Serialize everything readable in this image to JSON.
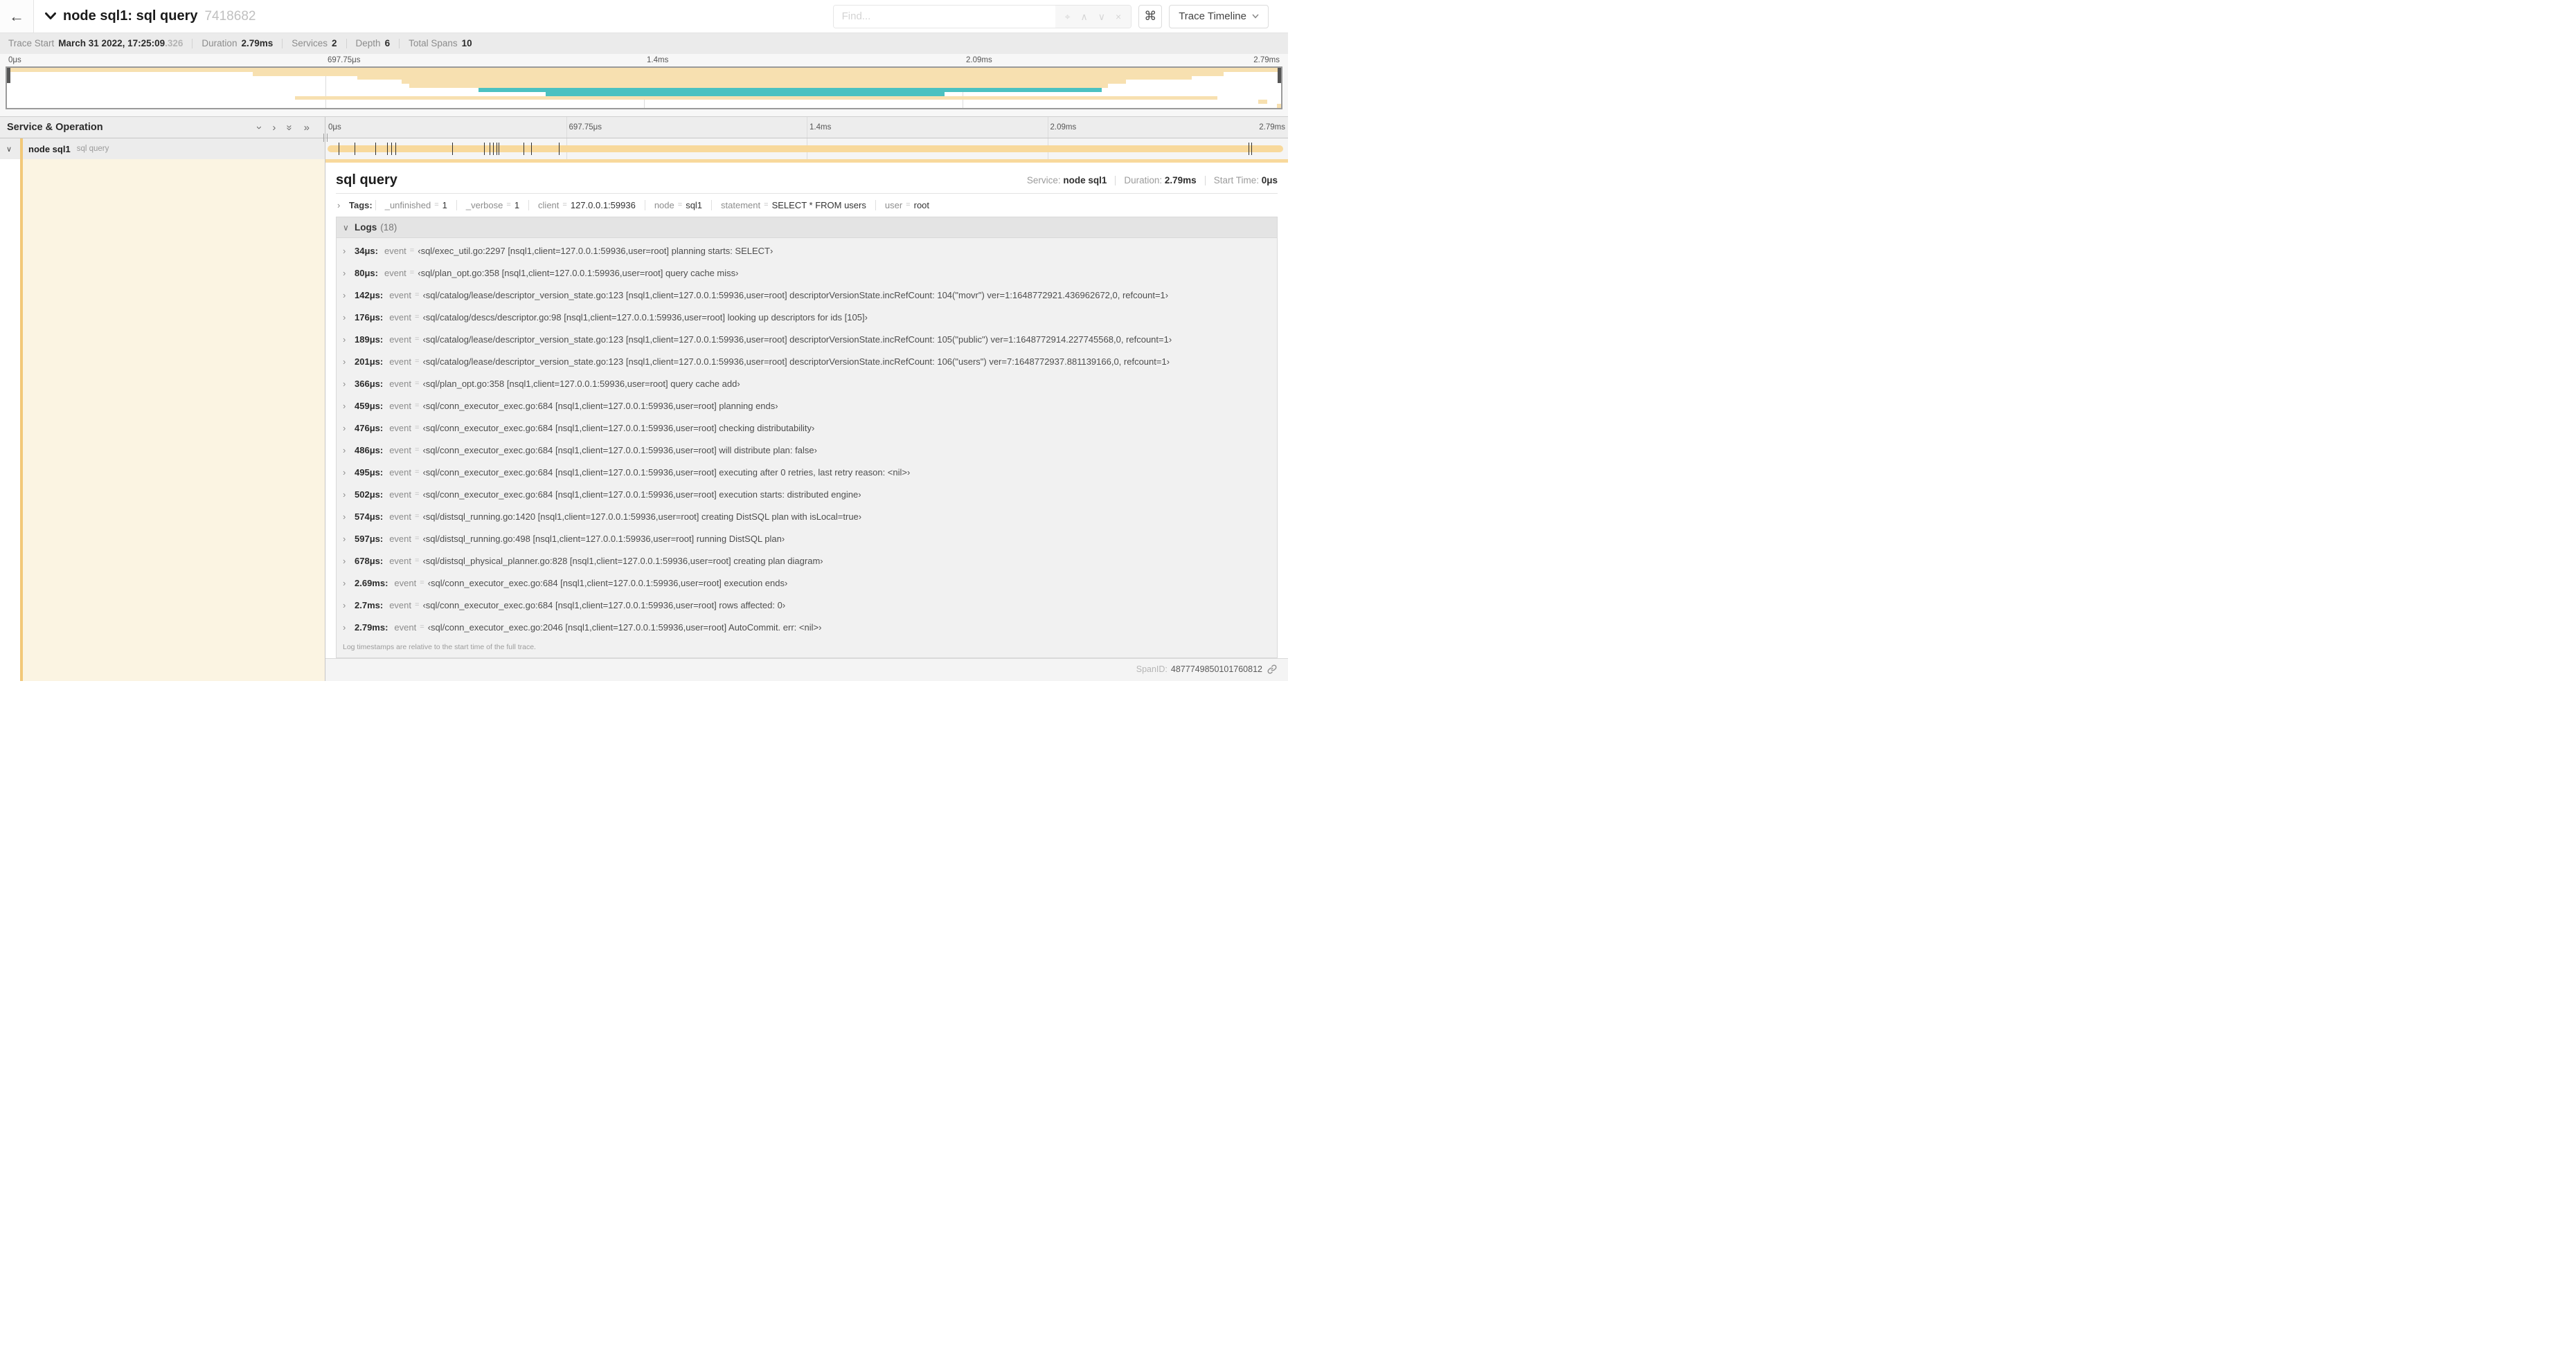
{
  "colors": {
    "amber_bar": "#F8D99C",
    "amber_light": "#F7E0B0",
    "amber_accent": "#F2C878",
    "teal": "#4BC1C1",
    "cream": "#FBF4E2"
  },
  "glyphs": {
    "back": "←",
    "chevron_down": "∨",
    "chevron_right": "›",
    "shortcut": "⌘"
  },
  "header": {
    "title": "node sql1: sql query",
    "trace_id": "7418682",
    "find": {
      "placeholder": "Find...",
      "icons": [
        {
          "name": "locate-icon",
          "glyph": "⌖"
        },
        {
          "name": "previous-match-icon",
          "glyph": "∧"
        },
        {
          "name": "next-match-icon",
          "glyph": "∨"
        },
        {
          "name": "clear-find-icon",
          "glyph": "×"
        }
      ]
    },
    "shortcut_label": "⌘",
    "view_button": "Trace Timeline"
  },
  "trace_info": {
    "items": [
      {
        "label": "Trace Start",
        "value": "March 31 2022, 17:25:09",
        "suffix": ".326"
      },
      {
        "label": "Duration",
        "value": "2.79ms"
      },
      {
        "label": "Services",
        "value": "2"
      },
      {
        "label": "Depth",
        "value": "6"
      },
      {
        "label": "Total Spans",
        "value": "10"
      }
    ]
  },
  "minimap": {
    "ticks": [
      {
        "label": "0μs",
        "pct": 0
      },
      {
        "label": "697.75μs",
        "pct": 25
      },
      {
        "label": "1.4ms",
        "pct": 50
      },
      {
        "label": "2.09ms",
        "pct": 75
      },
      {
        "label": "2.79ms",
        "pct": 100,
        "align": "right"
      }
    ],
    "grid_pcts": [
      25,
      50,
      75
    ],
    "spans": [
      {
        "start": 0,
        "end": 100,
        "color": "amber_light"
      },
      {
        "start": 19.3,
        "end": 95.5,
        "color": "amber_light"
      },
      {
        "start": 27.5,
        "end": 93,
        "color": "amber_light"
      },
      {
        "start": 31,
        "end": 87.8,
        "color": "amber_light"
      },
      {
        "start": 31.6,
        "end": 86.4,
        "color": "amber_light"
      },
      {
        "start": 37,
        "end": 85.9,
        "color": "teal"
      },
      {
        "start": 42.3,
        "end": 73.6,
        "color": "teal"
      },
      {
        "start": 22.6,
        "end": 95,
        "color": "amber_light"
      },
      {
        "start": 98.2,
        "end": 98.9,
        "color": "amber_light"
      },
      {
        "start": 99.7,
        "end": 100,
        "color": "amber_light"
      }
    ]
  },
  "timeline": {
    "column_header": "Service & Operation",
    "icons": [
      {
        "name": "collapse-one-icon",
        "glyph": "›",
        "rotate": true
      },
      {
        "name": "expand-one-icon",
        "glyph": "›",
        "rotate": false
      },
      {
        "name": "collapse-all-icon",
        "glyph": "»",
        "rotate": true
      },
      {
        "name": "expand-all-icon",
        "glyph": "»",
        "rotate": false
      }
    ],
    "ticks": [
      {
        "label": "0μs",
        "pct": 0
      },
      {
        "label": "697.75μs",
        "pct": 25
      },
      {
        "label": "1.4ms",
        "pct": 50
      },
      {
        "label": "2.09ms",
        "pct": 75
      },
      {
        "label": "2.79ms",
        "pct": 100,
        "align": "right"
      }
    ],
    "grid_pcts": [
      25,
      50,
      75
    ],
    "row": {
      "service": "node sql1",
      "operation": "sql query"
    }
  },
  "detail": {
    "title": "sql query",
    "meta": [
      {
        "label": "Service:",
        "value": "node sql1"
      },
      {
        "label": "Duration:",
        "value": "2.79ms"
      },
      {
        "label": "Start Time:",
        "value": "0μs"
      }
    ],
    "tags_label": "Tags:",
    "tags": [
      {
        "key": "_unfinished",
        "value": "1"
      },
      {
        "key": "_verbose",
        "value": "1"
      },
      {
        "key": "client",
        "value": "127.0.0.1:59936"
      },
      {
        "key": "node",
        "value": "sql1"
      },
      {
        "key": "statement",
        "value": "SELECT * FROM users"
      },
      {
        "key": "user",
        "value": "root"
      }
    ],
    "logs": {
      "label": "Logs",
      "count": "(18)",
      "kv_key": "event",
      "entries": [
        {
          "time": "34μs:",
          "pct": 1.219,
          "value": "‹sql/exec_util.go:2297 [nsql1,client=127.0.0.1:59936,user=root] planning starts: SELECT›"
        },
        {
          "time": "80μs:",
          "pct": 2.867,
          "value": "‹sql/plan_opt.go:358 [nsql1,client=127.0.0.1:59936,user=root] query cache miss›"
        },
        {
          "time": "142μs:",
          "pct": 5.09,
          "value": "‹sql/catalog/lease/descriptor_version_state.go:123 [nsql1,client=127.0.0.1:59936,user=root] descriptorVersionState.incRefCount: 104(\"movr\") ver=1:1648772921.436962672,0, refcount=1›"
        },
        {
          "time": "176μs:",
          "pct": 6.309,
          "value": "‹sql/catalog/descs/descriptor.go:98 [nsql1,client=127.0.0.1:59936,user=root] looking up descriptors for ids [105]›"
        },
        {
          "time": "189μs:",
          "pct": 6.774,
          "value": "‹sql/catalog/lease/descriptor_version_state.go:123 [nsql1,client=127.0.0.1:59936,user=root] descriptorVersionState.incRefCount: 105(\"public\") ver=1:1648772914.227745568,0, refcount=1›"
        },
        {
          "time": "201μs:",
          "pct": 7.204,
          "value": "‹sql/catalog/lease/descriptor_version_state.go:123 [nsql1,client=127.0.0.1:59936,user=root] descriptorVersionState.incRefCount: 106(\"users\") ver=7:1648772937.881139166,0, refcount=1›"
        },
        {
          "time": "366μs:",
          "pct": 13.118,
          "value": "‹sql/plan_opt.go:358 [nsql1,client=127.0.0.1:59936,user=root] query cache add›"
        },
        {
          "time": "459μs:",
          "pct": 16.452,
          "value": "‹sql/conn_executor_exec.go:684 [nsql1,client=127.0.0.1:59936,user=root] planning ends›"
        },
        {
          "time": "476μs:",
          "pct": 17.061,
          "value": "‹sql/conn_executor_exec.go:684 [nsql1,client=127.0.0.1:59936,user=root] checking distributability›"
        },
        {
          "time": "486μs:",
          "pct": 17.419,
          "value": "‹sql/conn_executor_exec.go:684 [nsql1,client=127.0.0.1:59936,user=root] will distribute plan: false›"
        },
        {
          "time": "495μs:",
          "pct": 17.742,
          "value": "‹sql/conn_executor_exec.go:684 [nsql1,client=127.0.0.1:59936,user=root] executing after 0 retries, last retry reason: <nil>›"
        },
        {
          "time": "502μs:",
          "pct": 17.993,
          "value": "‹sql/conn_executor_exec.go:684 [nsql1,client=127.0.0.1:59936,user=root] execution starts: distributed engine›"
        },
        {
          "time": "574μs:",
          "pct": 20.573,
          "value": "‹sql/distsql_running.go:1420 [nsql1,client=127.0.0.1:59936,user=root] creating DistSQL plan with isLocal=true›"
        },
        {
          "time": "597μs:",
          "pct": 21.398,
          "value": "‹sql/distsql_running.go:498 [nsql1,client=127.0.0.1:59936,user=root] running DistSQL plan›"
        },
        {
          "time": "678μs:",
          "pct": 24.301,
          "value": "‹sql/distsql_physical_planner.go:828 [nsql1,client=127.0.0.1:59936,user=root] creating plan diagram›"
        },
        {
          "time": "2.69ms:",
          "pct": 96.416,
          "value": "‹sql/conn_executor_exec.go:684 [nsql1,client=127.0.0.1:59936,user=root] execution ends›"
        },
        {
          "time": "2.7ms:",
          "pct": 96.774,
          "value": "‹sql/conn_executor_exec.go:684 [nsql1,client=127.0.0.1:59936,user=root] rows affected: 0›"
        },
        {
          "time": "2.79ms:",
          "pct": 100,
          "value": "‹sql/conn_executor_exec.go:2046 [nsql1,client=127.0.0.1:59936,user=root] AutoCommit. err: <nil>›"
        }
      ],
      "footer": "Log timestamps are relative to the start time of the full trace."
    },
    "span_id_label": "SpanID:",
    "span_id": "4877749850101760812"
  }
}
